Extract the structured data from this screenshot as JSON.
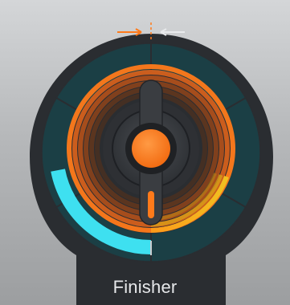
{
  "plugin": {
    "name": "Finisher"
  },
  "colors": {
    "background_top": "#d4d6d8",
    "background_bottom": "#9c9ea0",
    "panel": "#2a2d31",
    "outer_ring_track": "#1b3f45",
    "amount_arc": "#3ee0f0",
    "orange_accent": "#ff7a1a",
    "yellow_arc": "#e8b020",
    "knob_body": "#3a3d41",
    "knob_cap": "#ff7a22"
  },
  "direction_indicator": {
    "left_arrow_icon": "arrow-right-icon",
    "right_arrow_icon": "arrow-left-icon"
  },
  "controls": {
    "amount_fraction": 0.22,
    "mode_fraction": 0.5
  }
}
